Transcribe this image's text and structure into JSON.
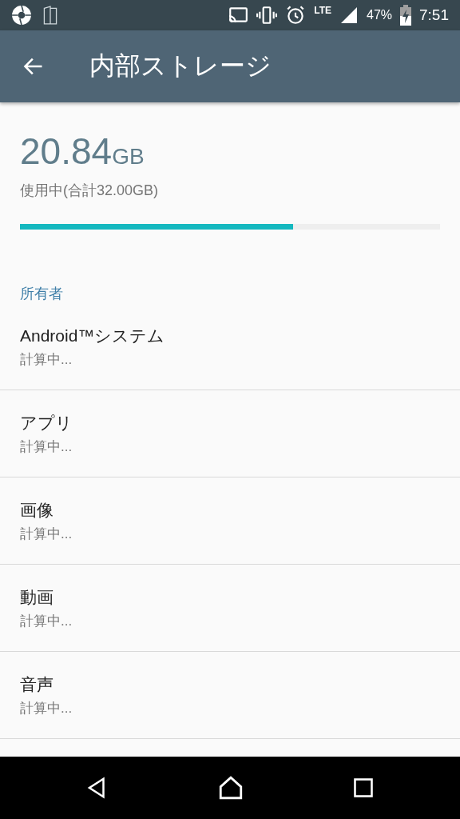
{
  "status_bar": {
    "network": "LTE",
    "battery": "47%",
    "time": "7:51"
  },
  "app_bar": {
    "title": "内部ストレージ"
  },
  "usage": {
    "amount": "20.84",
    "unit": "GB",
    "caption": "使用中(合計32.00GB)",
    "level": 0.65
  },
  "section": {
    "title": "所有者"
  },
  "items": [
    {
      "title": "Android™システム",
      "subtitle": "計算中..."
    },
    {
      "title": "アプリ",
      "subtitle": "計算中..."
    },
    {
      "title": "画像",
      "subtitle": "計算中..."
    },
    {
      "title": "動画",
      "subtitle": "計算中..."
    },
    {
      "title": "音声",
      "subtitle": "計算中..."
    }
  ]
}
